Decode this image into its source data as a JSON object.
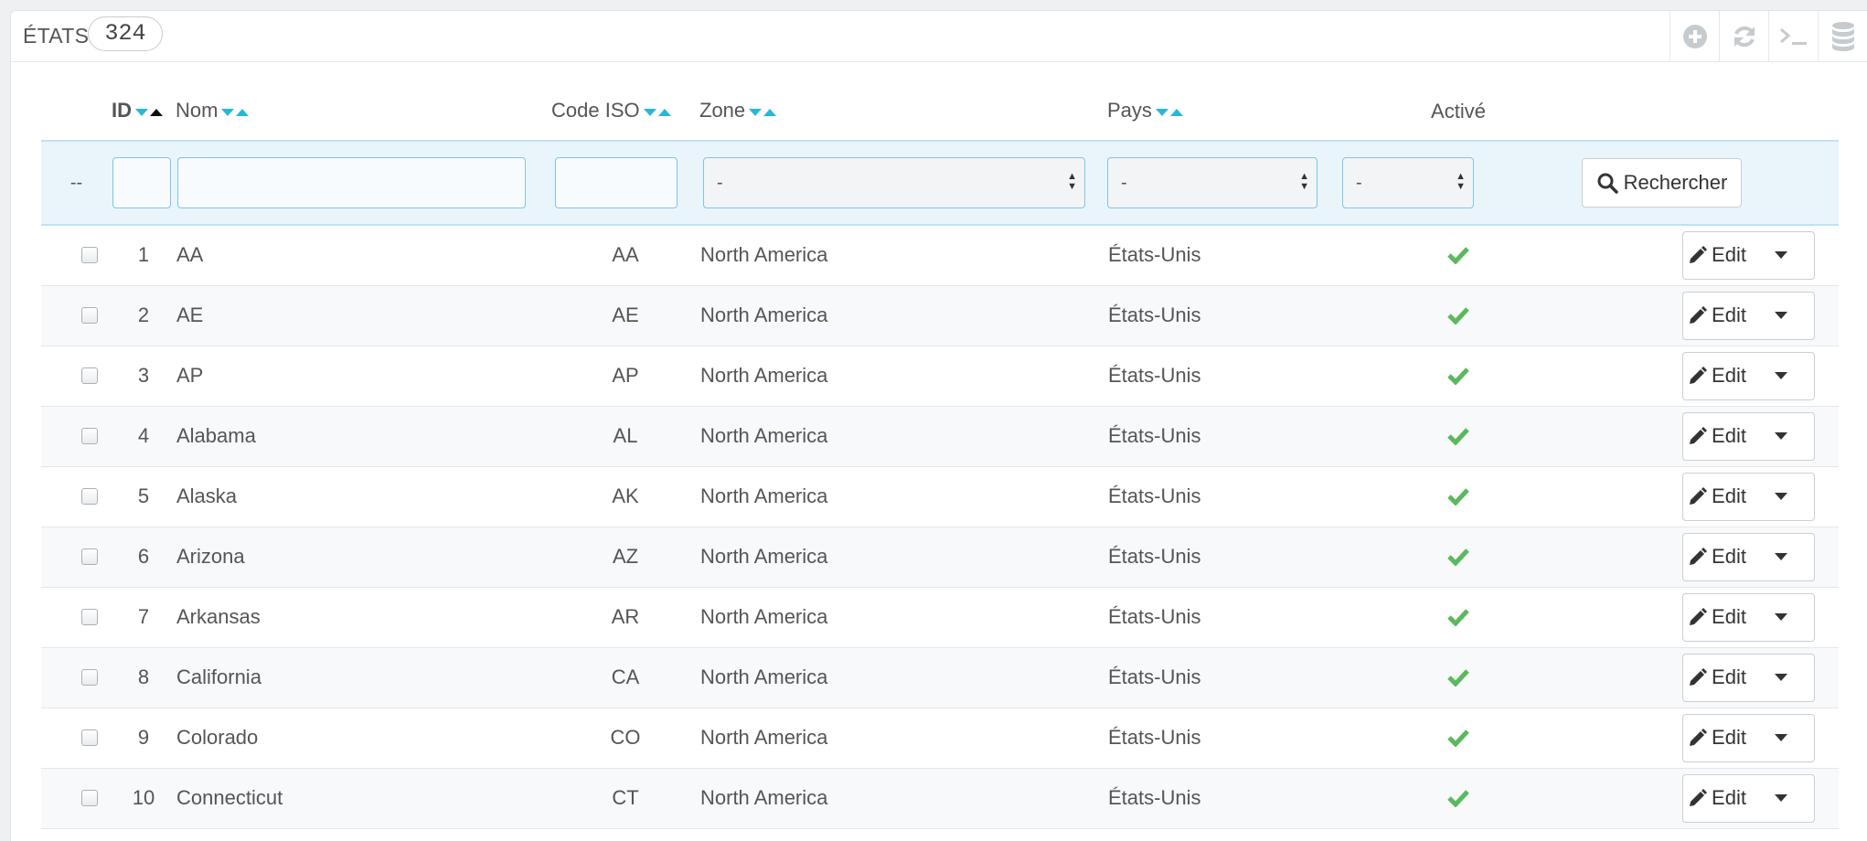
{
  "panel": {
    "title": "ÉTATS",
    "count": "324"
  },
  "toolbar": {
    "icons": [
      "add-icon",
      "refresh-icon",
      "sql-terminal-icon",
      "database-icon"
    ]
  },
  "columns": {
    "id": "ID",
    "name": "Nom",
    "iso": "Code ISO",
    "zone": "Zone",
    "country": "Pays",
    "active": "Activé"
  },
  "filters": {
    "bulk_placeholder": "--",
    "zone_value": "-",
    "country_value": "-",
    "active_value": "-",
    "search_label": "Rechercher"
  },
  "rows": [
    {
      "id": "1",
      "name": "AA",
      "iso": "AA",
      "zone": "North America",
      "country": "États-Unis",
      "active": true,
      "action": "Edit"
    },
    {
      "id": "2",
      "name": "AE",
      "iso": "AE",
      "zone": "North America",
      "country": "États-Unis",
      "active": true,
      "action": "Edit"
    },
    {
      "id": "3",
      "name": "AP",
      "iso": "AP",
      "zone": "North America",
      "country": "États-Unis",
      "active": true,
      "action": "Edit"
    },
    {
      "id": "4",
      "name": "Alabama",
      "iso": "AL",
      "zone": "North America",
      "country": "États-Unis",
      "active": true,
      "action": "Edit"
    },
    {
      "id": "5",
      "name": "Alaska",
      "iso": "AK",
      "zone": "North America",
      "country": "États-Unis",
      "active": true,
      "action": "Edit"
    },
    {
      "id": "6",
      "name": "Arizona",
      "iso": "AZ",
      "zone": "North America",
      "country": "États-Unis",
      "active": true,
      "action": "Edit"
    },
    {
      "id": "7",
      "name": "Arkansas",
      "iso": "AR",
      "zone": "North America",
      "country": "États-Unis",
      "active": true,
      "action": "Edit"
    },
    {
      "id": "8",
      "name": "California",
      "iso": "CA",
      "zone": "North America",
      "country": "États-Unis",
      "active": true,
      "action": "Edit"
    },
    {
      "id": "9",
      "name": "Colorado",
      "iso": "CO",
      "zone": "North America",
      "country": "États-Unis",
      "active": true,
      "action": "Edit"
    },
    {
      "id": "10",
      "name": "Connecticut",
      "iso": "CT",
      "zone": "North America",
      "country": "États-Unis",
      "active": true,
      "action": "Edit"
    }
  ],
  "colors": {
    "accent": "#25b9d7",
    "check": "#5cb85c",
    "filter_bg": "#eaf5fb",
    "filter_border": "#7fc5e6"
  }
}
